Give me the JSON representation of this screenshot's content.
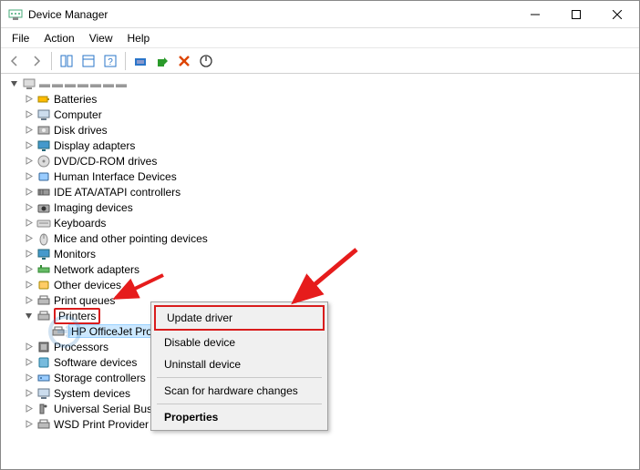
{
  "window": {
    "title": "Device Manager"
  },
  "menus": {
    "file": "File",
    "action": "Action",
    "view": "View",
    "help": "Help"
  },
  "tree": {
    "root": "DESKTOP-XXXXXXX",
    "items": [
      "Batteries",
      "Computer",
      "Disk drives",
      "Display adapters",
      "DVD/CD-ROM drives",
      "Human Interface Devices",
      "IDE ATA/ATAPI controllers",
      "Imaging devices",
      "Keyboards",
      "Mice and other pointing devices",
      "Monitors",
      "Network adapters",
      "Other devices",
      "Print queues",
      "Printers",
      "Processors",
      "Software devices",
      "Storage controllers",
      "System devices",
      "Universal Serial Bus",
      "WSD Print Provider"
    ],
    "selected_child": "HP OfficeJet Pro"
  },
  "context_menu": {
    "update": "Update driver",
    "disable": "Disable device",
    "uninstall": "Uninstall device",
    "scan": "Scan for hardware changes",
    "properties": "Properties"
  }
}
